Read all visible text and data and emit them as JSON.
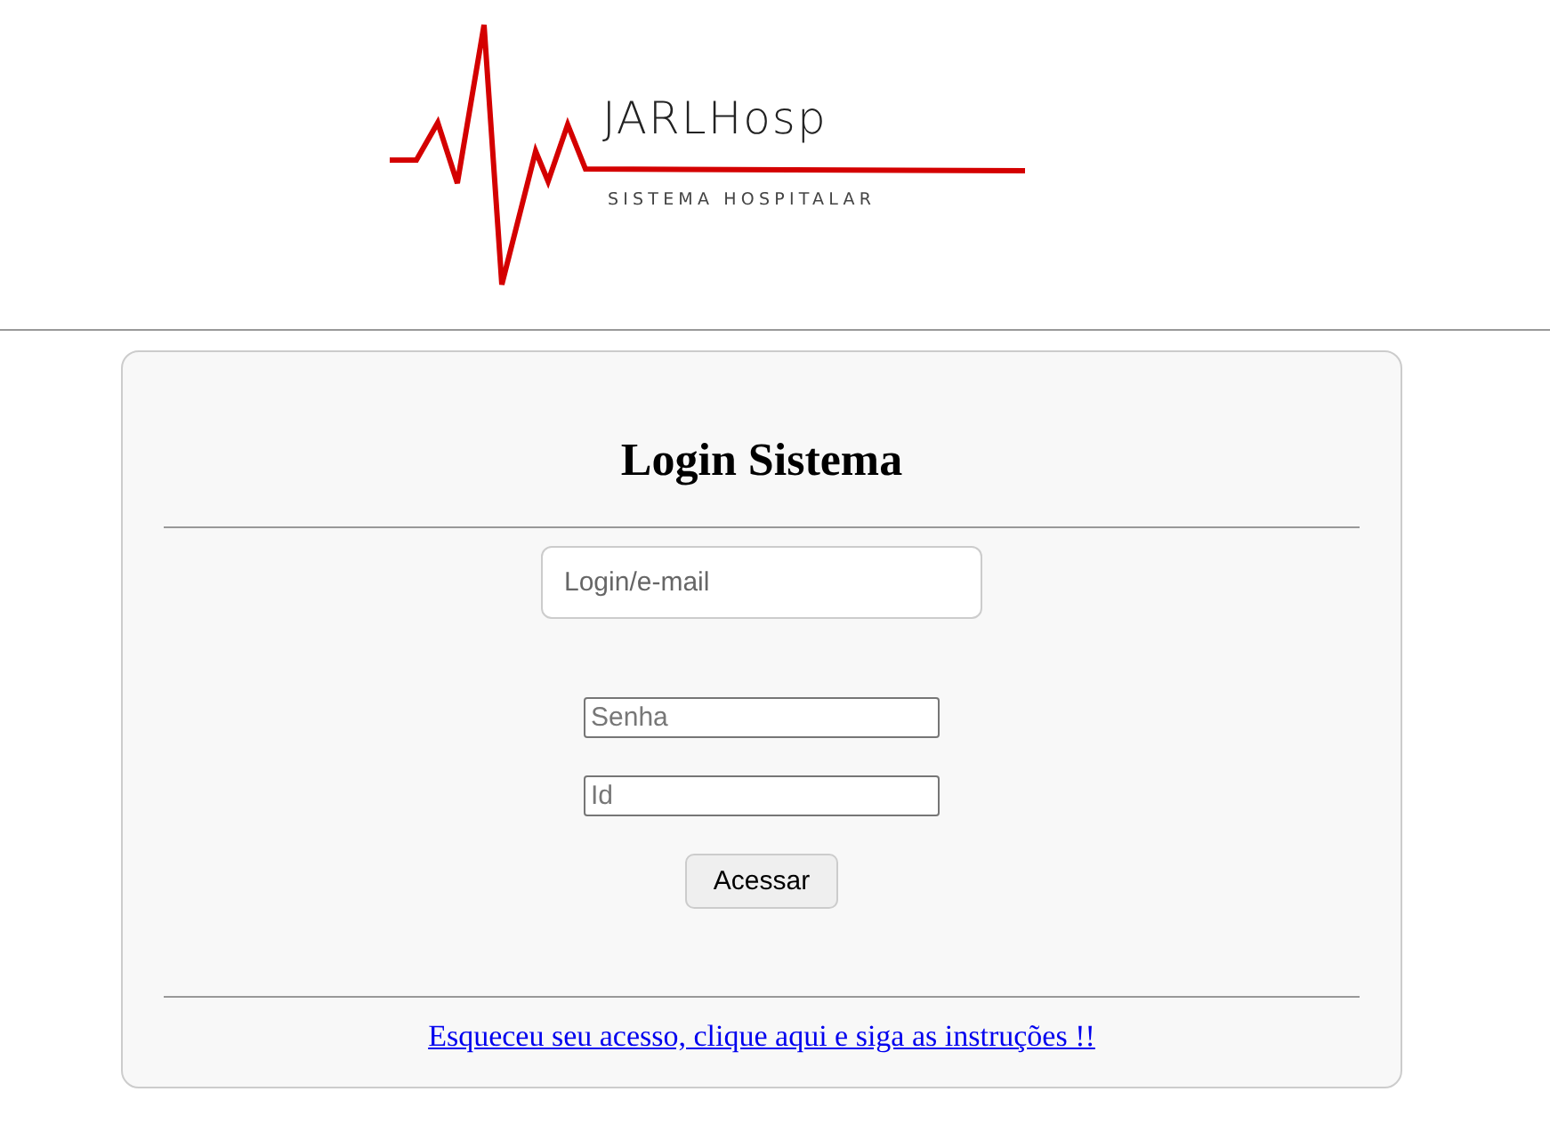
{
  "logo": {
    "name": "JARLHosp",
    "tagline": "SISTEMA HOSPITALAR"
  },
  "login": {
    "title": "Login Sistema",
    "fields": [
      {
        "kind": "large",
        "placeholder": "Login/e-mail"
      },
      {
        "kind": "small",
        "placeholder": "Senha"
      },
      {
        "kind": "small",
        "placeholder": "Id"
      }
    ],
    "button": "Acessar",
    "link": "Esqueceu seu acesso, clique aqui e siga as instruções !!"
  }
}
